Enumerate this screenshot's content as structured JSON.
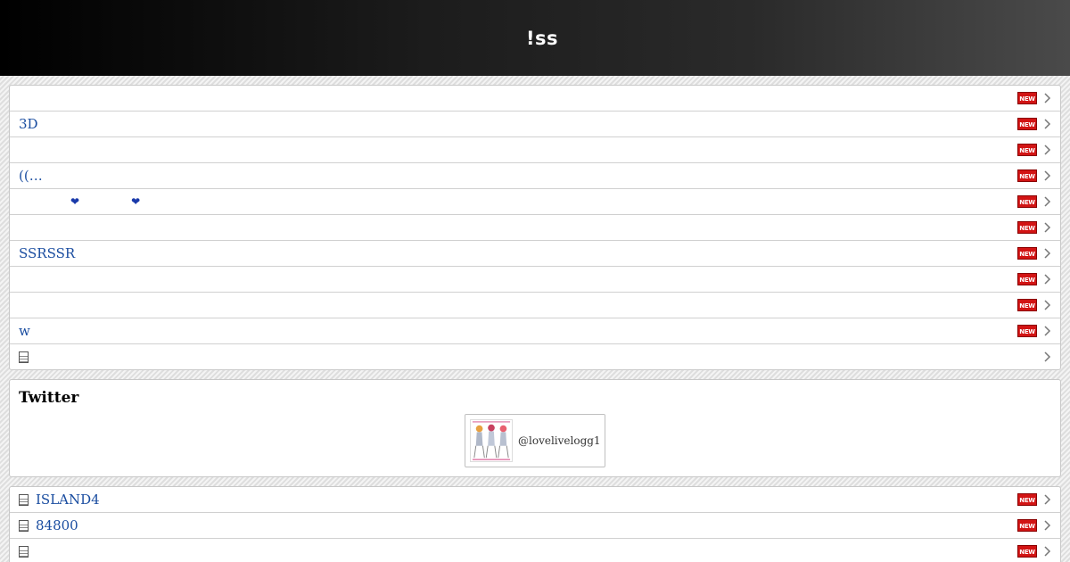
{
  "header": {
    "title": "!ss"
  },
  "badge_label": "NEW",
  "list1": [
    {
      "label": "",
      "new": true
    },
    {
      "label": "3D",
      "new": true
    },
    {
      "label": "",
      "new": true
    },
    {
      "label": "((…",
      "new": true
    },
    {
      "label": "",
      "hearts": [
        "❤",
        "❤"
      ],
      "new": true
    },
    {
      "label": "",
      "new": true
    },
    {
      "label": "SSRSSR",
      "new": true
    },
    {
      "label": "",
      "new": true
    },
    {
      "label": "",
      "new": true
    },
    {
      "label": "w",
      "new": true
    },
    {
      "label": "",
      "doc_icon": true,
      "new": false
    }
  ],
  "twitter": {
    "title": "Twitter",
    "handle": "@lovelivelogg1"
  },
  "list2": [
    {
      "label": "ISLAND4",
      "doc_icon": true,
      "new": true
    },
    {
      "label": "84800",
      "doc_icon": true,
      "new": true
    },
    {
      "label": "",
      "doc_icon": true,
      "new": true
    }
  ],
  "colors": {
    "link": "#1a4da0",
    "badge": "#d21414",
    "header_dark": "#000000",
    "header_light": "#4a4a4a"
  }
}
